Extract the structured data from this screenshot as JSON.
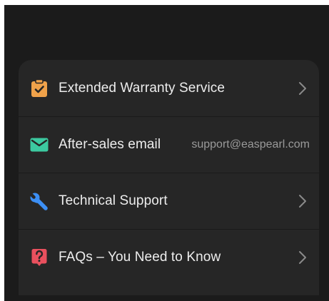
{
  "menu": {
    "items": [
      {
        "label": "Extended Warranty Service",
        "icon": "clipboard-check-icon",
        "icon_color": "#F0A24A",
        "action": "chevron-right-icon"
      },
      {
        "label": "After-sales email",
        "value": "support@easpearl.com",
        "icon": "mail-icon",
        "icon_color": "#3CC9A0"
      },
      {
        "label": "Technical Support",
        "icon": "wrench-icon",
        "icon_color": "#3C8FF5",
        "action": "chevron-right-icon"
      },
      {
        "label": "FAQs – You Need to Know",
        "icon": "question-icon",
        "icon_color": "#E9505E",
        "action": "chevron-right-icon"
      }
    ]
  },
  "colors": {
    "background": "#1b1b1b",
    "card": "#262626",
    "text": "#ededed",
    "secondary_text": "#9a9a9a"
  }
}
